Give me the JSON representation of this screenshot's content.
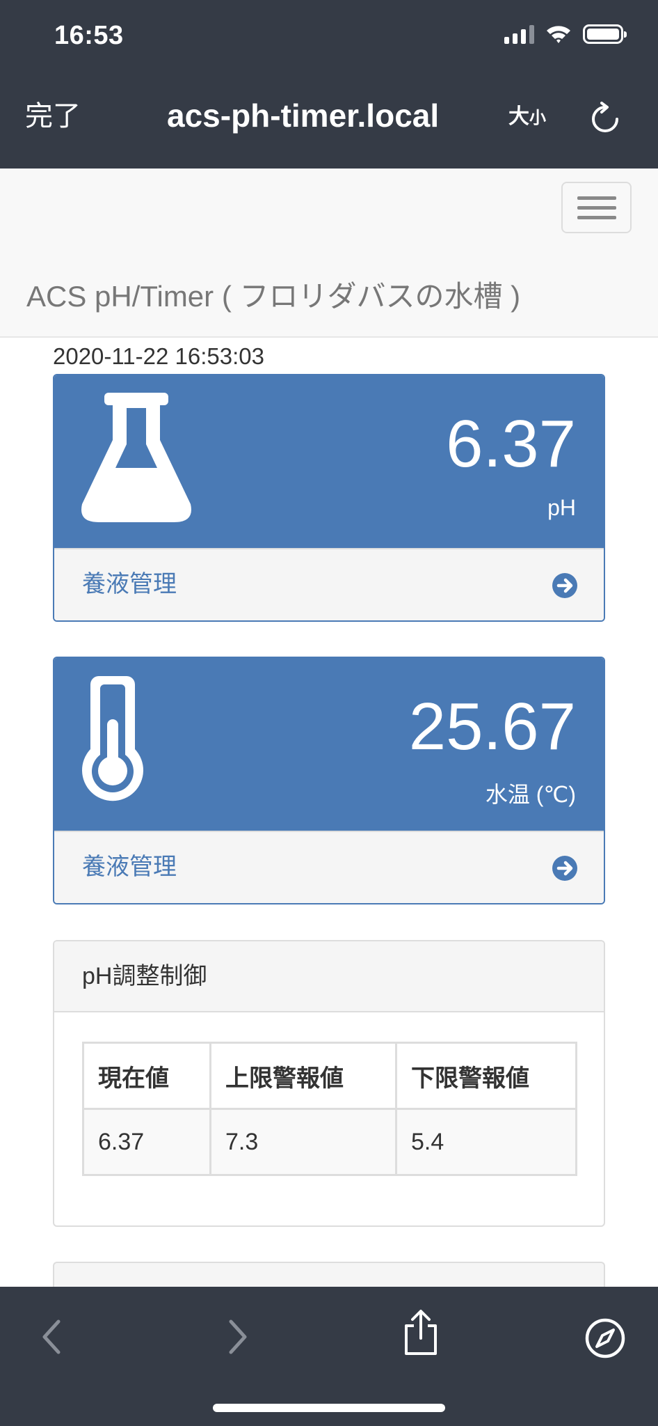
{
  "status_bar": {
    "time": "16:53",
    "icons": [
      "signal-icon",
      "wifi-icon",
      "battery-icon"
    ]
  },
  "browser_nav": {
    "done_label": "完了",
    "url": "acs-ph-timer.local",
    "text_size_large": "大",
    "text_size_small": "小",
    "reload_icon": "reload-icon"
  },
  "page_header": {
    "brand": "ACS pH/Timer ( フロリダバスの水槽 )",
    "menu_icon": "hamburger-icon"
  },
  "timestamp": "2020-11-22 16:53:03",
  "panels": [
    {
      "icon": "flask-icon",
      "value": "6.37",
      "unit": "pH",
      "footer_label": "養液管理",
      "footer_icon": "arrow-circle-right-icon"
    },
    {
      "icon": "thermometer-icon",
      "value": "25.67",
      "unit": "水温 (℃)",
      "footer_label": "養液管理",
      "footer_icon": "arrow-circle-right-icon"
    }
  ],
  "ph_control": {
    "title": "pH調整制御",
    "columns": [
      "現在値",
      "上限警報値",
      "下限警報値"
    ],
    "row": [
      "6.37",
      "7.3",
      "5.4"
    ]
  },
  "toolbar": {
    "icons": [
      "back-icon",
      "forward-icon",
      "share-icon",
      "compass-icon"
    ]
  },
  "colors": {
    "chrome": "#353b46",
    "panel_primary": "#4a7ab5",
    "page_header_bg": "#f8f8f8"
  }
}
